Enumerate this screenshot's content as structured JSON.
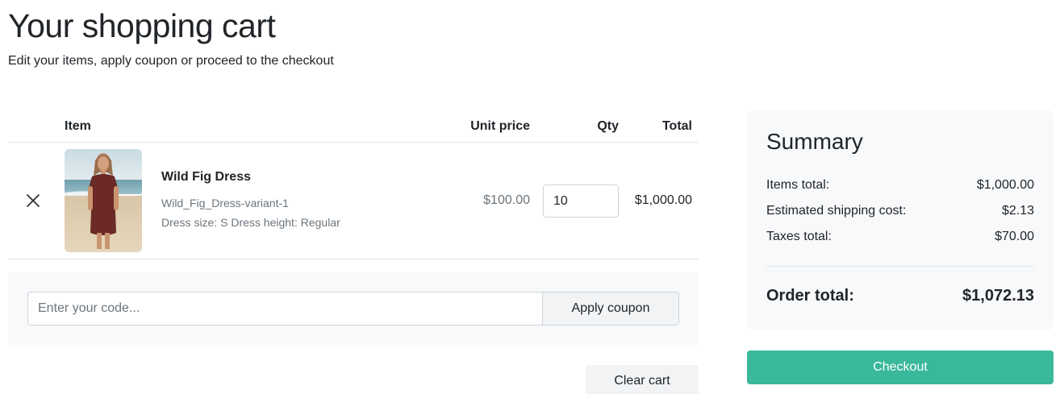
{
  "header": {
    "title": "Your shopping cart",
    "subtitle": "Edit your items, apply coupon or proceed to the checkout"
  },
  "cart": {
    "columns": {
      "item": "Item",
      "unit_price": "Unit price",
      "qty": "Qty",
      "total": "Total"
    },
    "items": [
      {
        "name": "Wild Fig Dress",
        "variant": "Wild_Fig_Dress-variant-1",
        "attributes": "Dress size: S Dress height: Regular",
        "unit_price": "$100.00",
        "qty": "10",
        "total": "$1,000.00",
        "remove_icon": "close-icon",
        "image": "product-image-wild-fig-dress"
      }
    ]
  },
  "coupon": {
    "placeholder": "Enter your code...",
    "button_label": "Apply coupon"
  },
  "actions": {
    "clear_cart_label": "Clear cart",
    "checkout_label": "Checkout"
  },
  "summary": {
    "title": "Summary",
    "rows": [
      {
        "label": "Items total:",
        "value": "$1,000.00"
      },
      {
        "label": "Estimated shipping cost:",
        "value": "$2.13"
      },
      {
        "label": "Taxes total:",
        "value": "$70.00"
      }
    ],
    "order_total_label": "Order total:",
    "order_total_value": "$1,072.13"
  },
  "colors": {
    "accent": "#3ab89b",
    "panel_bg": "#f8f9fa",
    "muted_text": "#6c757d"
  }
}
